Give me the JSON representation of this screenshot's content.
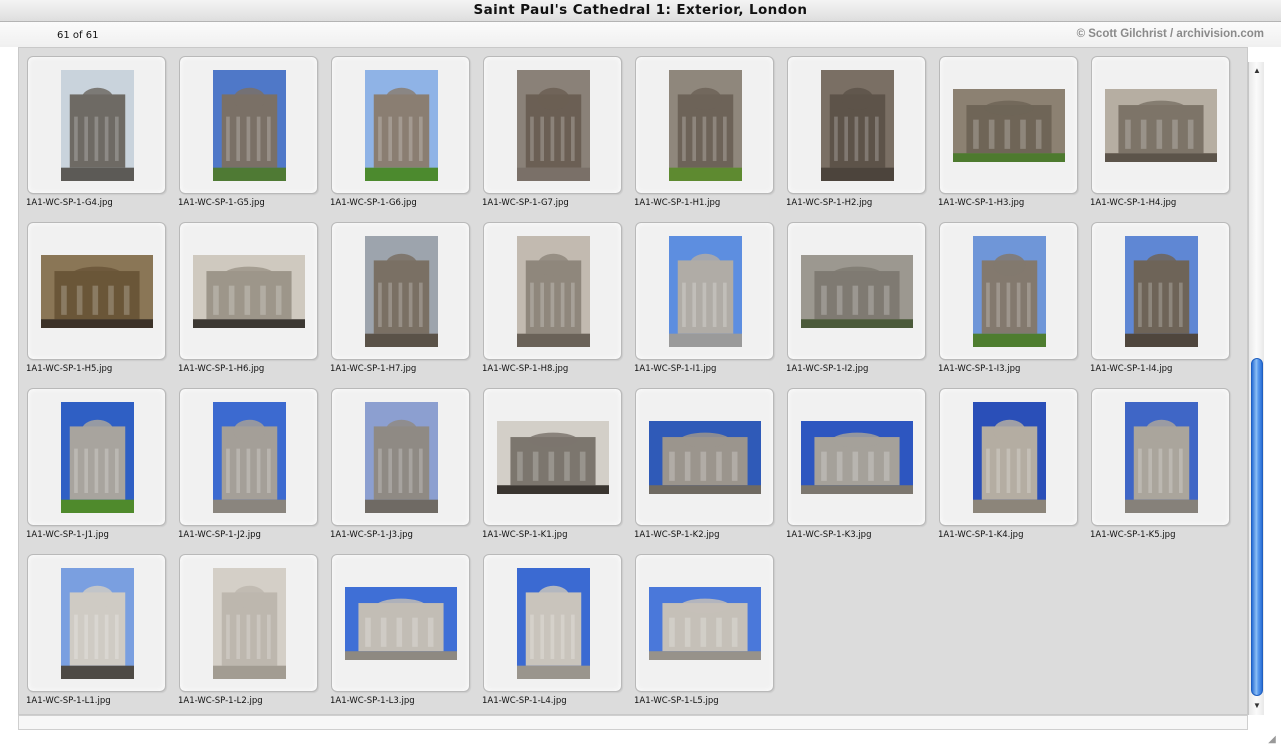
{
  "window": {
    "title": "Saint Paul's Cathedral 1: Exterior, London"
  },
  "header": {
    "count": "61 of 61",
    "credit": "© Scott Gilchrist / archivision.com"
  },
  "thumbnails": [
    {
      "filename": "1A1-WC-SP-1-G4.jpg",
      "orientation": "portrait",
      "sky": "#c9d3dc",
      "stone": "#6e6a64",
      "ground": "#5c5a56"
    },
    {
      "filename": "1A1-WC-SP-1-G5.jpg",
      "orientation": "portrait",
      "sky": "#4f78c8",
      "stone": "#7a7066",
      "ground": "#4f7a34"
    },
    {
      "filename": "1A1-WC-SP-1-G6.jpg",
      "orientation": "portrait",
      "sky": "#8fb3e6",
      "stone": "#8a7e72",
      "ground": "#4c8a2e"
    },
    {
      "filename": "1A1-WC-SP-1-G7.jpg",
      "orientation": "portrait",
      "sky": "#8a8178",
      "stone": "#6b5f54",
      "ground": "#7a7068"
    },
    {
      "filename": "1A1-WC-SP-1-H1.jpg",
      "orientation": "portrait",
      "sky": "#8f877c",
      "stone": "#6d6358",
      "ground": "#5e8a30"
    },
    {
      "filename": "1A1-WC-SP-1-H2.jpg",
      "orientation": "portrait",
      "sky": "#7a6f64",
      "stone": "#5d5349",
      "ground": "#4c443c"
    },
    {
      "filename": "1A1-WC-SP-1-H3.jpg",
      "orientation": "landscape",
      "sky": "#8c8172",
      "stone": "#6f6557",
      "ground": "#4d7a2e"
    },
    {
      "filename": "1A1-WC-SP-1-H4.jpg",
      "orientation": "landscape",
      "sky": "#b6aea2",
      "stone": "#7d7468",
      "ground": "#5c544a"
    },
    {
      "filename": "1A1-WC-SP-1-H5.jpg",
      "orientation": "landscape",
      "sky": "#8a7656",
      "stone": "#6a5638",
      "ground": "#3c3228"
    },
    {
      "filename": "1A1-WC-SP-1-H6.jpg",
      "orientation": "landscape",
      "sky": "#cfc9bf",
      "stone": "#9d968a",
      "ground": "#3c3833"
    },
    {
      "filename": "1A1-WC-SP-1-H7.jpg",
      "orientation": "portrait",
      "sky": "#9da4ad",
      "stone": "#7a7064",
      "ground": "#5a5248"
    },
    {
      "filename": "1A1-WC-SP-1-H8.jpg",
      "orientation": "portrait",
      "sky": "#c2bab0",
      "stone": "#8f877c",
      "ground": "#6a6258"
    },
    {
      "filename": "1A1-WC-SP-1-I1.jpg",
      "orientation": "portrait",
      "sky": "#5d8ee0",
      "stone": "#b0aca6",
      "ground": "#9a9a9a"
    },
    {
      "filename": "1A1-WC-SP-1-I2.jpg",
      "orientation": "landscape",
      "sky": "#9c9890",
      "stone": "#7f7a72",
      "ground": "#4b5a3a"
    },
    {
      "filename": "1A1-WC-SP-1-I3.jpg",
      "orientation": "portrait",
      "sky": "#6f96d8",
      "stone": "#83796e",
      "ground": "#4e7d2f"
    },
    {
      "filename": "1A1-WC-SP-1-I4.jpg",
      "orientation": "portrait",
      "sky": "#5f87d4",
      "stone": "#6e6458",
      "ground": "#4f463d"
    },
    {
      "filename": "1A1-WC-SP-1-J1.jpg",
      "orientation": "portrait",
      "sky": "#2f5fc4",
      "stone": "#a8a49e",
      "ground": "#4f8a2c"
    },
    {
      "filename": "1A1-WC-SP-1-J2.jpg",
      "orientation": "portrait",
      "sky": "#3c6ad0",
      "stone": "#a49f98",
      "ground": "#8a857e"
    },
    {
      "filename": "1A1-WC-SP-1-J3.jpg",
      "orientation": "portrait",
      "sky": "#8c9fd0",
      "stone": "#8f8a84",
      "ground": "#6f6a64"
    },
    {
      "filename": "1A1-WC-SP-1-K1.jpg",
      "orientation": "landscape",
      "sky": "#d3cfc8",
      "stone": "#7c766e",
      "ground": "#3a3530"
    },
    {
      "filename": "1A1-WC-SP-1-K2.jpg",
      "orientation": "landscape",
      "sky": "#2f5ab8",
      "stone": "#9b958d",
      "ground": "#6f6a62"
    },
    {
      "filename": "1A1-WC-SP-1-K3.jpg",
      "orientation": "landscape",
      "sky": "#2d56c0",
      "stone": "#a5a19a",
      "ground": "#7c776f"
    },
    {
      "filename": "1A1-WC-SP-1-K4.jpg",
      "orientation": "portrait",
      "sky": "#2a4fb8",
      "stone": "#b4ada2",
      "ground": "#8c857a"
    },
    {
      "filename": "1A1-WC-SP-1-K5.jpg",
      "orientation": "portrait",
      "sky": "#3f66c6",
      "stone": "#aaa59c",
      "ground": "#86817a"
    },
    {
      "filename": "1A1-WC-SP-1-L1.jpg",
      "orientation": "portrait",
      "sky": "#7a9fe0",
      "stone": "#cfcbc4",
      "ground": "#4e4a45"
    },
    {
      "filename": "1A1-WC-SP-1-L2.jpg",
      "orientation": "portrait",
      "sky": "#d4cfc7",
      "stone": "#bdb7ae",
      "ground": "#a29c92"
    },
    {
      "filename": "1A1-WC-SP-1-L3.jpg",
      "orientation": "landscape",
      "sky": "#3f6fd6",
      "stone": "#c2bdb5",
      "ground": "#8e8981"
    },
    {
      "filename": "1A1-WC-SP-1-L4.jpg",
      "orientation": "portrait",
      "sky": "#3b6ad2",
      "stone": "#c9c4bc",
      "ground": "#9a958d"
    },
    {
      "filename": "1A1-WC-SP-1-L5.jpg",
      "orientation": "landscape",
      "sky": "#4a78da",
      "stone": "#c5c0b8",
      "ground": "#97928a"
    }
  ]
}
